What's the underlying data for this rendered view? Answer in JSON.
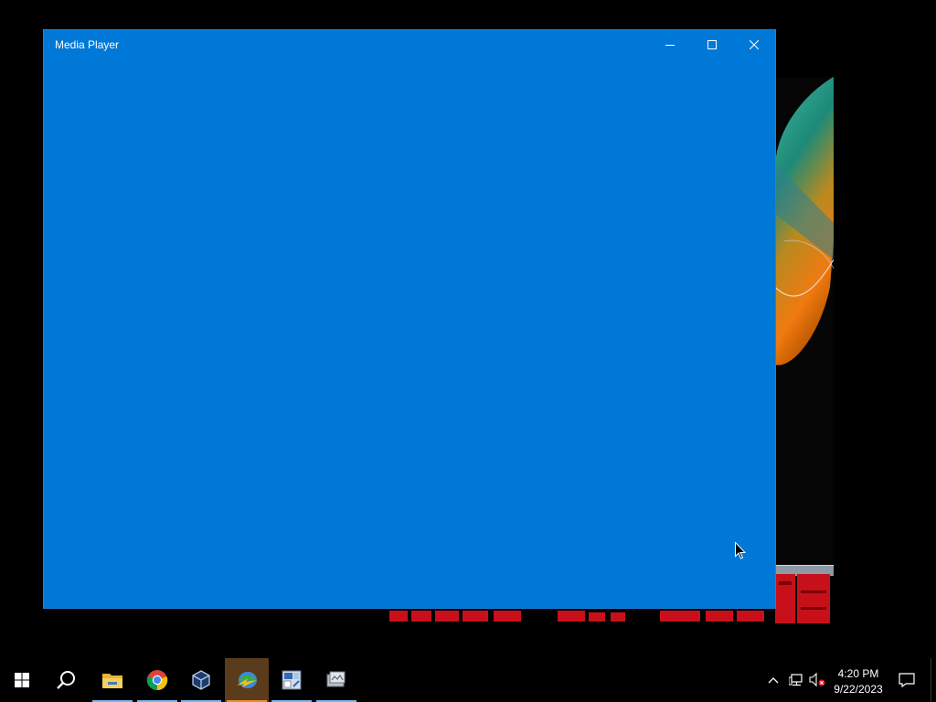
{
  "window": {
    "title": "Media Player",
    "background_color": "#0078d7",
    "controls": {
      "minimize_icon": "minimize-icon",
      "maximize_icon": "maximize-icon",
      "close_icon": "close-icon"
    }
  },
  "taskbar": {
    "start_icon": "windows-logo-icon",
    "search_icon": "search-icon",
    "pinned_apps": [
      {
        "name": "File Explorer",
        "icon": "folder-icon",
        "running": true
      },
      {
        "name": "Google Chrome",
        "icon": "chrome-icon",
        "running": true
      },
      {
        "name": "VirtualBox",
        "icon": "cube-icon",
        "running": true
      },
      {
        "name": "Internet Download Manager",
        "icon": "globe-download-icon",
        "running": true,
        "active": true
      },
      {
        "name": "Calculator",
        "icon": "calculator-icon",
        "running": true
      },
      {
        "name": "Media Player",
        "icon": "media-icon",
        "running": true
      }
    ],
    "tray": {
      "chevron_icon": "chevron-up-icon",
      "network_icon": "network-icon",
      "volume_icon": "volume-muted-icon",
      "time": "4:20 PM",
      "date": "9/22/2023",
      "notification_icon": "notification-icon"
    },
    "accent_active": "#f08c2c",
    "accent_running": "#76b9ed"
  }
}
